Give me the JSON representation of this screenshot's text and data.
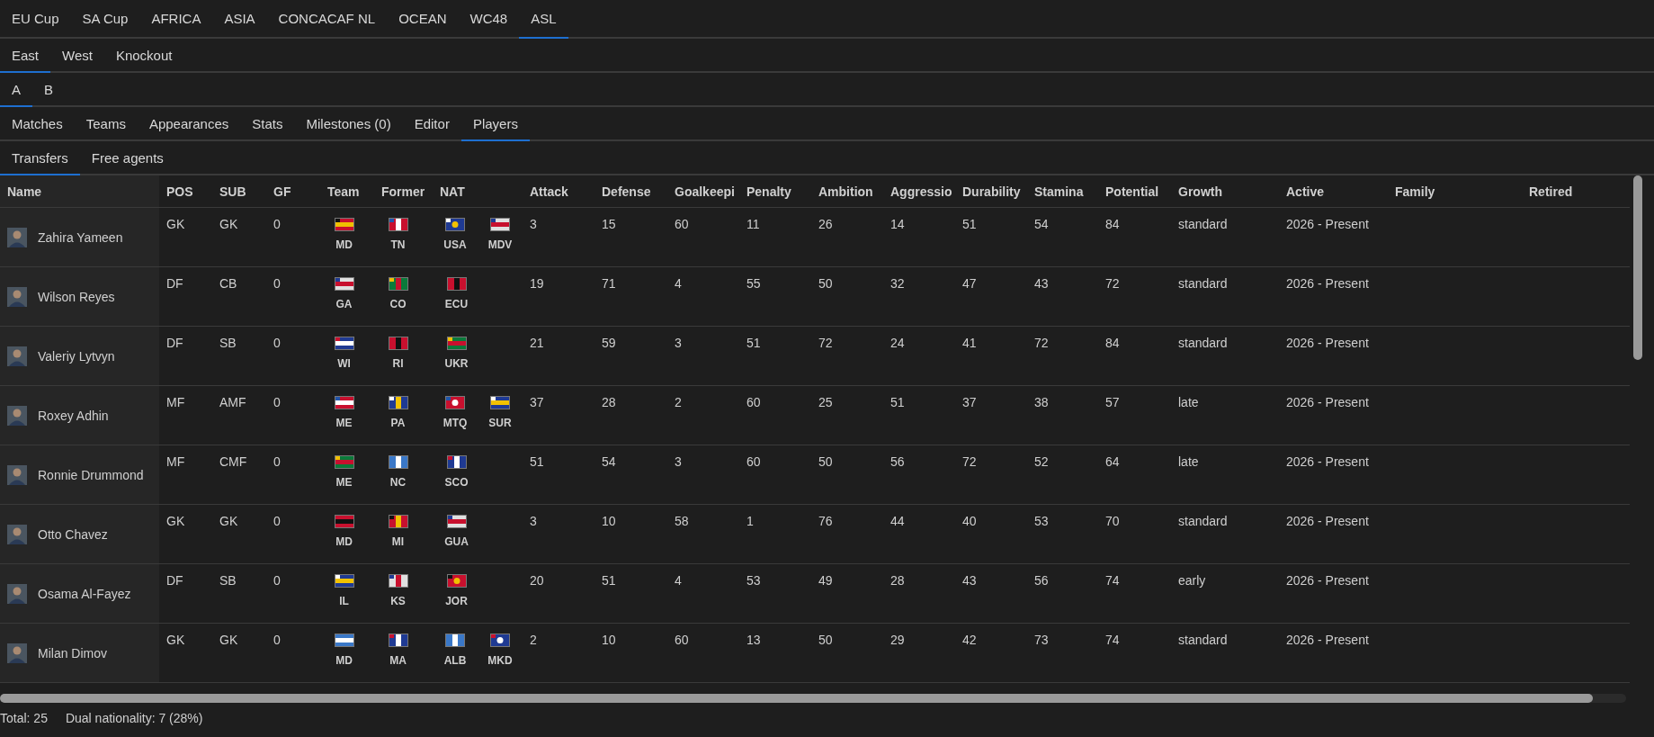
{
  "tab_rows": [
    {
      "tabs": [
        {
          "label": "EU Cup",
          "selected": false
        },
        {
          "label": "SA Cup",
          "selected": false
        },
        {
          "label": "AFRICA",
          "selected": false
        },
        {
          "label": "ASIA",
          "selected": false
        },
        {
          "label": "CONCACAF NL",
          "selected": false
        },
        {
          "label": "OCEAN",
          "selected": false
        },
        {
          "label": "WC48",
          "selected": false
        },
        {
          "label": "ASL",
          "selected": true
        }
      ]
    },
    {
      "tabs": [
        {
          "label": "East",
          "selected": true
        },
        {
          "label": "West",
          "selected": false
        },
        {
          "label": "Knockout",
          "selected": false
        }
      ]
    },
    {
      "tabs": [
        {
          "label": "A",
          "selected": true
        },
        {
          "label": "B",
          "selected": false
        }
      ]
    },
    {
      "tabs": [
        {
          "label": "Matches",
          "selected": false
        },
        {
          "label": "Teams",
          "selected": false
        },
        {
          "label": "Appearances",
          "selected": false
        },
        {
          "label": "Stats",
          "selected": false
        },
        {
          "label": "Milestones (0)",
          "selected": false
        },
        {
          "label": "Editor",
          "selected": false
        },
        {
          "label": "Players",
          "selected": true
        }
      ]
    },
    {
      "tabs": [
        {
          "label": "Transfers",
          "selected": true
        },
        {
          "label": "Free agents",
          "selected": false
        }
      ]
    }
  ],
  "table": {
    "columns": [
      "Name",
      "POS",
      "SUB",
      "GF",
      "Team",
      "Former",
      "NAT",
      "Attack",
      "Defense",
      "Goalkeepi",
      "Penalty",
      "Ambition",
      "Aggressio",
      "Durability",
      "Stamina",
      "Potential",
      "Growth",
      "Active",
      "Family",
      "Retired"
    ],
    "rows": [
      {
        "name": "Zahira Yameen",
        "pos": "GK",
        "sub": "GK",
        "gf": "0",
        "team": "MD",
        "former": "TN",
        "nat": [
          "USA",
          "MDV"
        ],
        "stats": [
          "3",
          "15",
          "60",
          "11",
          "26",
          "14",
          "51",
          "54",
          "84"
        ],
        "growth": "standard",
        "active": "2026 - Present"
      },
      {
        "name": "Wilson Reyes",
        "pos": "DF",
        "sub": "CB",
        "gf": "0",
        "team": "GA",
        "former": "CO",
        "nat": [
          "ECU"
        ],
        "stats": [
          "19",
          "71",
          "4",
          "55",
          "50",
          "32",
          "47",
          "43",
          "72"
        ],
        "growth": "standard",
        "active": "2026 - Present"
      },
      {
        "name": "Valeriy Lytvyn",
        "pos": "DF",
        "sub": "SB",
        "gf": "0",
        "team": "WI",
        "former": "RI",
        "nat": [
          "UKR"
        ],
        "stats": [
          "21",
          "59",
          "3",
          "51",
          "72",
          "24",
          "41",
          "72",
          "84"
        ],
        "growth": "standard",
        "active": "2026 - Present"
      },
      {
        "name": "Roxey Adhin",
        "pos": "MF",
        "sub": "AMF",
        "gf": "0",
        "team": "ME",
        "former": "PA",
        "nat": [
          "MTQ",
          "SUR"
        ],
        "stats": [
          "37",
          "28",
          "2",
          "60",
          "25",
          "51",
          "37",
          "38",
          "57"
        ],
        "growth": "late",
        "active": "2026 - Present"
      },
      {
        "name": "Ronnie Drummond",
        "pos": "MF",
        "sub": "CMF",
        "gf": "0",
        "team": "ME",
        "former": "NC",
        "nat": [
          "SCO"
        ],
        "stats": [
          "51",
          "54",
          "3",
          "60",
          "50",
          "56",
          "72",
          "52",
          "64"
        ],
        "growth": "late",
        "active": "2026 - Present"
      },
      {
        "name": "Otto Chavez",
        "pos": "GK",
        "sub": "GK",
        "gf": "0",
        "team": "MD",
        "former": "MI",
        "nat": [
          "GUA"
        ],
        "stats": [
          "3",
          "10",
          "58",
          "1",
          "76",
          "44",
          "40",
          "53",
          "70"
        ],
        "growth": "standard",
        "active": "2026 - Present"
      },
      {
        "name": "Osama Al-Fayez",
        "pos": "DF",
        "sub": "SB",
        "gf": "0",
        "team": "IL",
        "former": "KS",
        "nat": [
          "JOR"
        ],
        "stats": [
          "20",
          "51",
          "4",
          "53",
          "49",
          "28",
          "43",
          "56",
          "74"
        ],
        "growth": "early",
        "active": "2026 - Present"
      },
      {
        "name": "Milan Dimov",
        "pos": "GK",
        "sub": "GK",
        "gf": "0",
        "team": "MD",
        "former": "MA",
        "nat": [
          "ALB",
          "MKD"
        ],
        "stats": [
          "2",
          "10",
          "60",
          "13",
          "50",
          "29",
          "42",
          "73",
          "74"
        ],
        "growth": "standard",
        "active": "2026 - Present"
      }
    ]
  },
  "footer": {
    "total": "Total: 25",
    "dual": "Dual nationality: 7 (28%)"
  }
}
